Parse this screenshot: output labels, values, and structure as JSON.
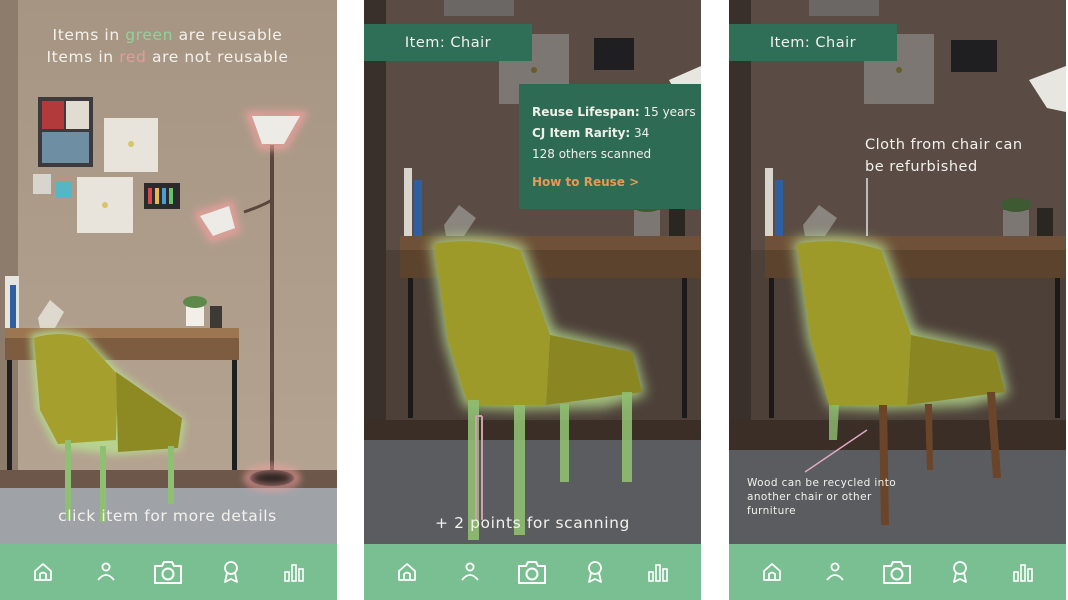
{
  "screen1": {
    "legend": {
      "line1_prefix": "Items in ",
      "line1_color_word": "green",
      "line1_suffix": " are reusable",
      "line2_prefix": "Items in ",
      "line2_color_word": "red",
      "line2_suffix": " are not reusable"
    },
    "hint": "click item for more details"
  },
  "screen2": {
    "item_label": "Item: Chair",
    "info": {
      "lifespan_label": "Reuse Lifespan:",
      "lifespan_value": " 15 years",
      "rarity_label": "CJ Item Rarity:",
      "rarity_value": " 34",
      "scanned": "128 others scanned",
      "link": "How to Reuse >"
    },
    "points": "+ 2 points for scanning"
  },
  "screen3": {
    "item_label": "Item: Chair",
    "note_cloth": "Cloth from chair can be refurbished",
    "note_wood": "Wood can be recycled into another chair or other furniture"
  },
  "tabs": [
    {
      "name": "home",
      "icon": "home-icon"
    },
    {
      "name": "profile",
      "icon": "person-icon"
    },
    {
      "name": "scan",
      "icon": "camera-icon"
    },
    {
      "name": "rewards",
      "icon": "award-icon"
    },
    {
      "name": "stats",
      "icon": "bar-chart-icon"
    }
  ],
  "colors": {
    "tabbar": "#79bf91",
    "panel": "#2e6b55",
    "reusable": "#8fd39a",
    "not_reusable": "#e79a9a",
    "link": "#e59a57"
  }
}
